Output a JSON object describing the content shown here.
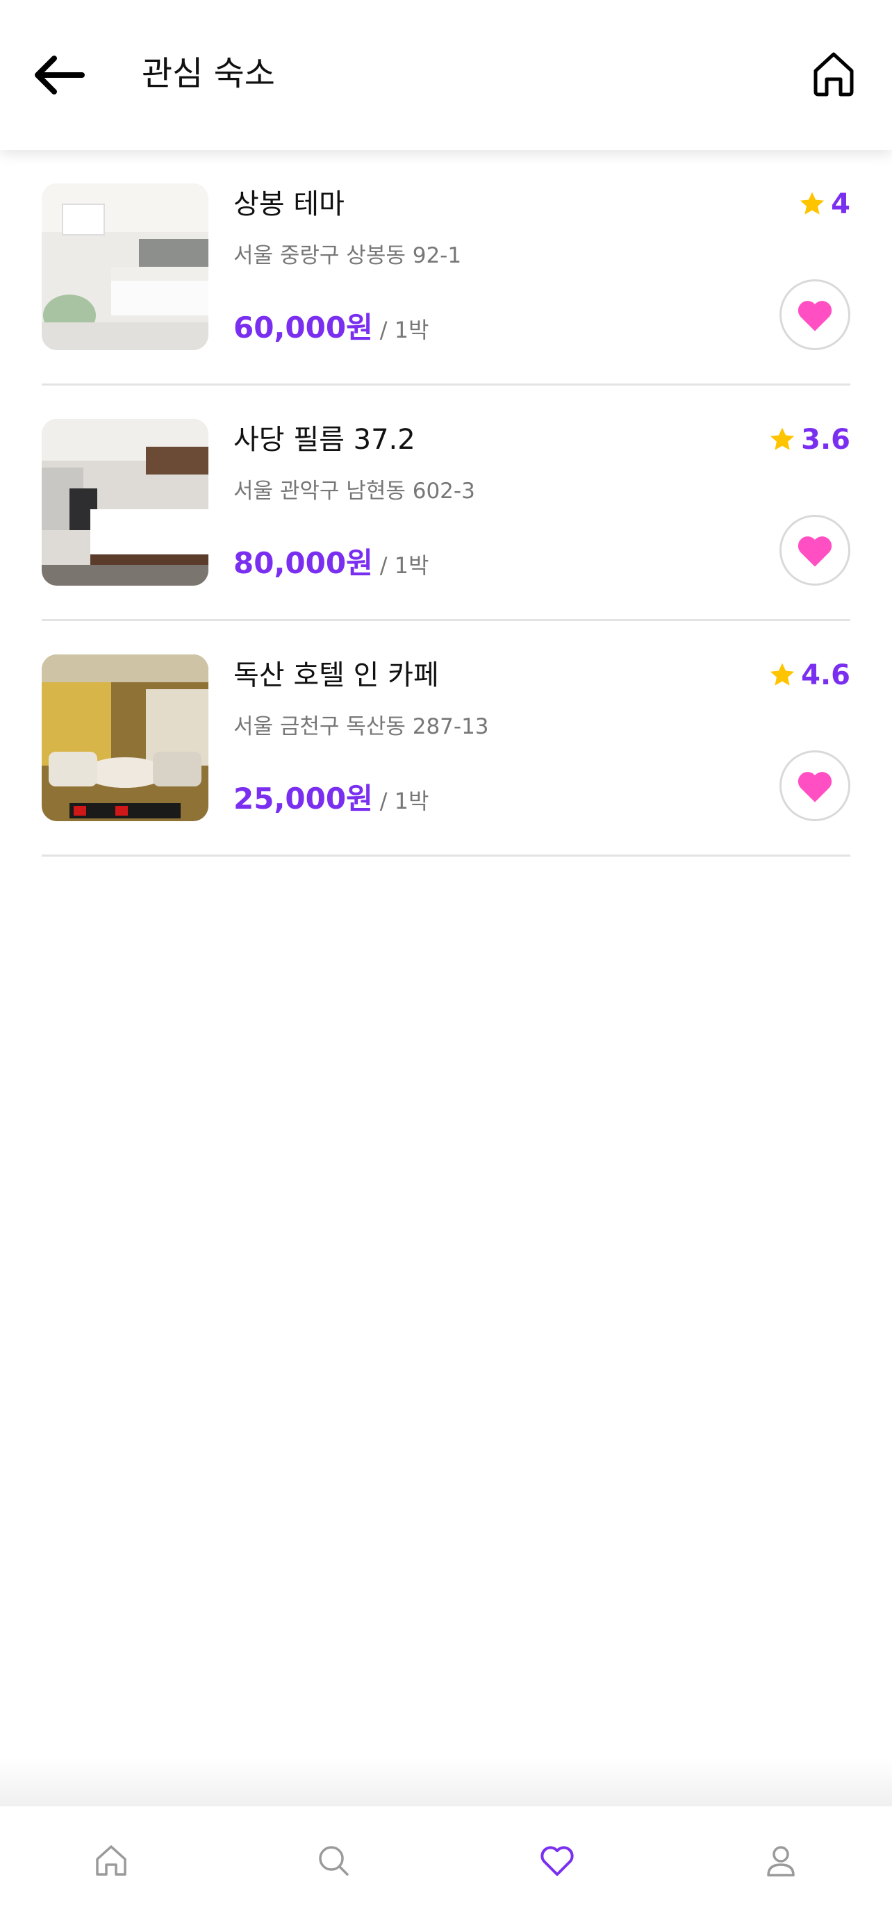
{
  "header": {
    "title": "관심 숙소"
  },
  "items": [
    {
      "name": "상봉 테마",
      "address": "서울 중랑구 상봉동 92-1",
      "price": "60,000원",
      "per_night": "/ 1박",
      "rating": "4"
    },
    {
      "name": "사당 필름 37.2",
      "address": "서울 관악구 남현동 602-3",
      "price": "80,000원",
      "per_night": "/ 1박",
      "rating": "3.6"
    },
    {
      "name": "독산 호텔 인 카페",
      "address": "서울 금천구 독산동 287-13",
      "price": "25,000원",
      "per_night": "/ 1박",
      "rating": "4.6"
    }
  ],
  "colors": {
    "accent": "#7a2ff0",
    "heart": "#ff4fc3",
    "star": "#ffc400",
    "nav_active": "#7a2ff0",
    "nav_inactive": "#9a9a9a"
  },
  "nav": [
    "home-icon",
    "search-icon",
    "heart-icon",
    "profile-icon"
  ],
  "nav_active": "heart-icon"
}
